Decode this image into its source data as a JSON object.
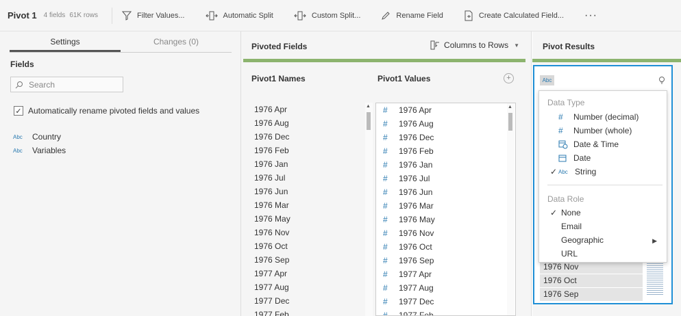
{
  "toolbar": {
    "title": "Pivot 1",
    "fields_count": "4 fields",
    "rows_count": "61K rows",
    "filter_values": "Filter Values...",
    "automatic_split": "Automatic Split",
    "custom_split": "Custom Split...",
    "rename_field": "Rename Field",
    "create_calculated_field": "Create Calculated Field...",
    "more": "···"
  },
  "left": {
    "tab_settings": "Settings",
    "tab_changes": "Changes (0)",
    "fields_heading": "Fields",
    "search_placeholder": "Search",
    "auto_rename_label": "Automatically rename pivoted fields and values",
    "fields": [
      {
        "type": "Abc",
        "name": "Country"
      },
      {
        "type": "Abc",
        "name": "Variables"
      }
    ]
  },
  "middle": {
    "title": "Pivoted Fields",
    "columns_to_rows": "Columns to Rows",
    "names_header": "Pivot1 Names",
    "values_header": "Pivot1 Values",
    "rows": [
      "1976 Apr",
      "1976 Aug",
      "1976 Dec",
      "1976 Feb",
      "1976 Jan",
      "1976 Jul",
      "1976 Jun",
      "1976 Mar",
      "1976 May",
      "1976 Nov",
      "1976 Oct",
      "1976 Sep",
      "1977 Apr",
      "1977 Aug",
      "1977 Dec",
      "1977 Feb"
    ]
  },
  "right": {
    "title": "Pivot Results",
    "type_badge": "Abc",
    "result_rows": [
      "1976 Nov",
      "1976 Oct",
      "1976 Sep"
    ]
  },
  "menu": {
    "data_type_label": "Data Type",
    "types": {
      "decimal": "Number (decimal)",
      "whole": "Number (whole)",
      "datetime": "Date & Time",
      "date": "Date",
      "string": "String",
      "string_badge": "Abc"
    },
    "data_role_label": "Data Role",
    "roles": {
      "none": "None",
      "email": "Email",
      "geographic": "Geographic",
      "url": "URL"
    },
    "selected_type": "String",
    "selected_role": "None"
  },
  "colors": {
    "accent_green": "#8cb46e",
    "selection_blue": "#1f8fd6",
    "type_icon_blue": "#2a7ab0"
  }
}
